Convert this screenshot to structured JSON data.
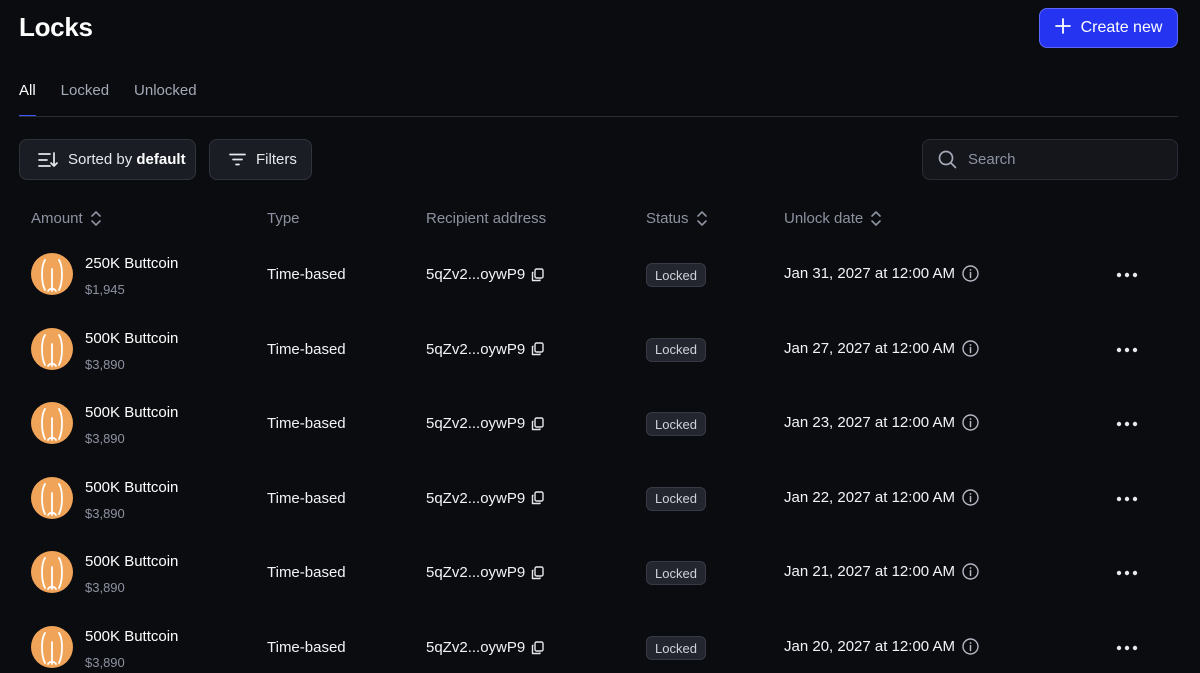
{
  "header": {
    "title": "Locks",
    "create_label": "Create new"
  },
  "tabs": [
    {
      "label": "All",
      "active": true
    },
    {
      "label": "Locked",
      "active": false
    },
    {
      "label": "Unlocked",
      "active": false
    }
  ],
  "toolbar": {
    "sort_prefix": "Sorted by",
    "sort_value": "default",
    "filters_label": "Filters",
    "search_placeholder": "Search"
  },
  "columns": {
    "amount": "Amount",
    "type": "Type",
    "recipient": "Recipient address",
    "status": "Status",
    "unlock_date": "Unlock date"
  },
  "rows": [
    {
      "amount": "250K Buttcoin",
      "usd": "$1,945",
      "type": "Time-based",
      "address": "5qZv2...oywP9",
      "status": "Locked",
      "date": "Jan 31, 2027 at 12:00 AM"
    },
    {
      "amount": "500K Buttcoin",
      "usd": "$3,890",
      "type": "Time-based",
      "address": "5qZv2...oywP9",
      "status": "Locked",
      "date": "Jan 27, 2027 at 12:00 AM"
    },
    {
      "amount": "500K Buttcoin",
      "usd": "$3,890",
      "type": "Time-based",
      "address": "5qZv2...oywP9",
      "status": "Locked",
      "date": "Jan 23, 2027 at 12:00 AM"
    },
    {
      "amount": "500K Buttcoin",
      "usd": "$3,890",
      "type": "Time-based",
      "address": "5qZv2...oywP9",
      "status": "Locked",
      "date": "Jan 22, 2027 at 12:00 AM"
    },
    {
      "amount": "500K Buttcoin",
      "usd": "$3,890",
      "type": "Time-based",
      "address": "5qZv2...oywP9",
      "status": "Locked",
      "date": "Jan 21, 2027 at 12:00 AM"
    },
    {
      "amount": "500K Buttcoin",
      "usd": "$3,890",
      "type": "Time-based",
      "address": "5qZv2...oywP9",
      "status": "Locked",
      "date": "Jan 20, 2027 at 12:00 AM"
    }
  ],
  "icons": {
    "create": "plus-icon",
    "sort": "sort-icon",
    "filters": "filter-icon",
    "search": "search-icon",
    "column_sort": "chevron-up-down-icon",
    "token": "buttcoin-logo-icon",
    "copy": "copy-icon",
    "info": "info-icon",
    "more": "more-horizontal-icon"
  },
  "colors": {
    "background": "#0b0c10",
    "accent": "#2434f0",
    "token": "#f0a459"
  }
}
